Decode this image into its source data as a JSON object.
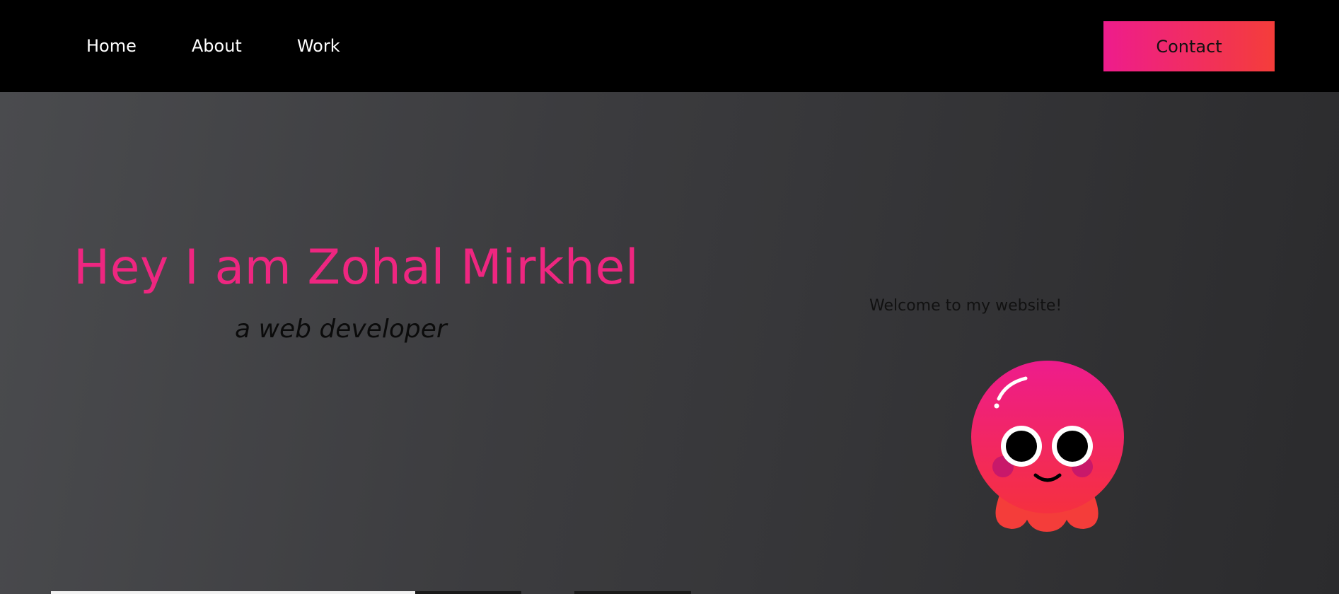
{
  "nav": {
    "items": [
      {
        "label": "Home"
      },
      {
        "label": "About"
      },
      {
        "label": "Work"
      }
    ],
    "contact_label": "Contact"
  },
  "hero": {
    "title": "Hey I am Zohal Mirkhel",
    "subtitle": "a web developer",
    "welcome": "Welcome to my website!"
  },
  "colors": {
    "accent_pink": "#ee1c8c",
    "accent_orange": "#f43d3a",
    "title_pink": "#ee2680",
    "nav_background": "#000000"
  },
  "icons": {
    "mascot": "octopus-mascot-icon"
  }
}
